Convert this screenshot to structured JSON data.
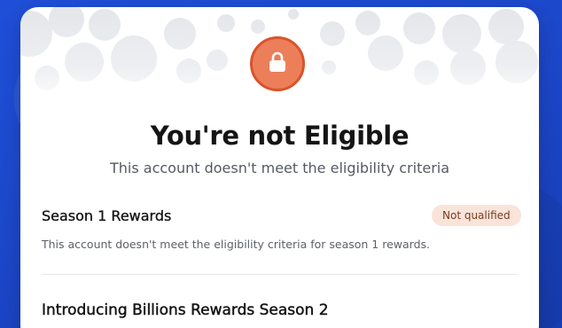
{
  "colors": {
    "background": "#1f4fd8",
    "card": "#ffffff",
    "lock_badge": "#ed7e5a",
    "lock_badge_border": "#d9542a",
    "status_badge_bg": "#f9e4da",
    "status_badge_text": "#7a3b22"
  },
  "header": {
    "icon": "lock-icon",
    "title": "You're not Eligible",
    "subtitle": "This account doesn't meet the eligibility criteria"
  },
  "season1": {
    "title": "Season 1 Rewards",
    "status": "Not qualified",
    "description": "This account doesn't meet the eligibility criteria for season 1 rewards."
  },
  "season2": {
    "title": "Introducing Billions Rewards Season 2"
  }
}
